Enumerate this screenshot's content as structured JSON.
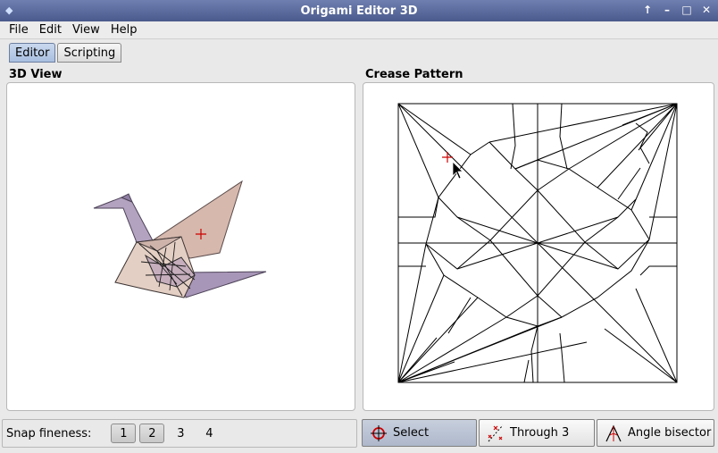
{
  "window": {
    "title": "Origami Editor 3D"
  },
  "menu": [
    "File",
    "Edit",
    "View",
    "Help"
  ],
  "tabs": [
    {
      "label": "Editor",
      "active": true
    },
    {
      "label": "Scripting",
      "active": false
    }
  ],
  "panels": {
    "view3d": {
      "title": "3D View"
    },
    "crease": {
      "title": "Crease Pattern"
    }
  },
  "snap": {
    "label": "Snap fineness:",
    "options": [
      "1",
      "2",
      "3",
      "4"
    ],
    "selected": [
      "1",
      "2"
    ]
  },
  "tools": [
    {
      "label": "Select",
      "icon": "crosshair-icon",
      "active": true
    },
    {
      "label": "Through 3",
      "icon": "through-three-icon",
      "active": false
    },
    {
      "label": "Angle bisector",
      "icon": "angle-bisector-icon",
      "active": false
    }
  ],
  "colors": {
    "accent": "#cc0000",
    "crane_fill": "#d8c0b8",
    "crane_shadow": "#9f8fb0"
  }
}
